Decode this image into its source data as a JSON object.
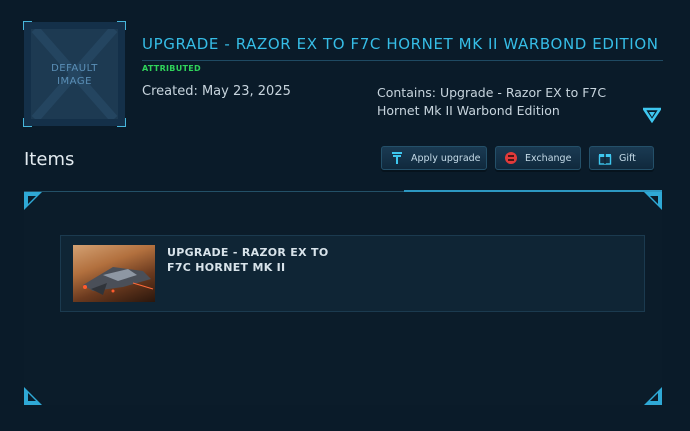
{
  "thumbnail": {
    "label_line1": "DEFAULT",
    "label_line2": "IMAGE"
  },
  "header": {
    "title": "UPGRADE - RAZOR EX TO F7C HORNET MK II WARBOND EDITION",
    "badge": "ATTRIBUTED",
    "created": "Created: May 23, 2025",
    "contains_line1": "Contains: Upgrade - Razor EX to F7C",
    "contains_line2": "Hornet Mk II Warbond Edition"
  },
  "items_heading": "Items",
  "actions": {
    "apply_upgrade": "Apply upgrade",
    "exchange": "Exchange",
    "gift": "Gift"
  },
  "item": {
    "name_line1": "UPGRADE - RAZOR EX TO",
    "name_line2": "F7C HORNET MK II"
  },
  "colors": {
    "accent": "#36bde6",
    "badge_green": "#2fd35a",
    "background": "#0a1b29",
    "exchange_icon": "#e23a3a"
  }
}
